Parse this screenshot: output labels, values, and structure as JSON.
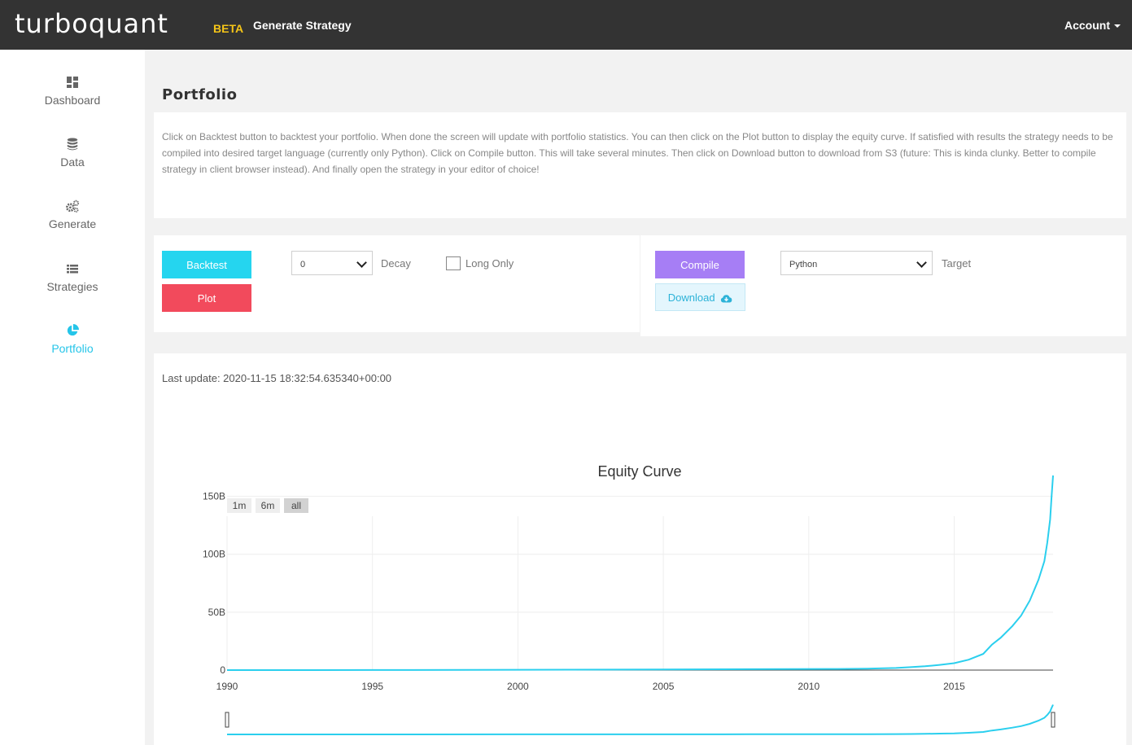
{
  "topbar": {
    "logo": "turboquant",
    "beta": "BETA",
    "generate_strategy": "Generate Strategy",
    "account": "Account"
  },
  "sidebar": {
    "items": [
      {
        "label": "Dashboard",
        "icon": "dashboard-icon",
        "active": false
      },
      {
        "label": "Data",
        "icon": "database-icon",
        "active": false
      },
      {
        "label": "Generate",
        "icon": "cogs-icon",
        "active": false
      },
      {
        "label": "Strategies",
        "icon": "list-icon",
        "active": false
      },
      {
        "label": "Portfolio",
        "icon": "pie-chart-icon",
        "active": true
      }
    ]
  },
  "page": {
    "title": "Portfolio",
    "description": "Click on Backtest button to backtest your portfolio. When done the screen will update with portfolio statistics. You can then click on the Plot button to display the equity curve. If satisfied with results the strategy needs to be compiled into desired target language (currently only Python). Click on Compile button. This will take several minutes. Then click on Download button to download from S3 (future: This is kinda clunky. Better to compile strategy in client browser instead). And finally open the strategy in your editor of choice!"
  },
  "controls": {
    "backtest_label": "Backtest",
    "plot_label": "Plot",
    "decay_value": "0",
    "decay_label": "Decay",
    "long_only_label": "Long Only",
    "long_only_checked": false,
    "compile_label": "Compile",
    "download_label": "Download",
    "target_value": "Python",
    "target_label": "Target"
  },
  "chart_panel": {
    "last_update": "Last update: 2020-11-15 18:32:54.635340+00:00"
  },
  "colors": {
    "accent": "#25c5e9",
    "backtest": "#25d5ef",
    "plot": "#f24a5c",
    "compile": "#a67ef5",
    "line": "#2bcfee"
  },
  "chart_data": {
    "type": "line",
    "title": "Equity Curve",
    "xlabel": "",
    "ylabel": "",
    "range_buttons": [
      "1m",
      "6m",
      "all"
    ],
    "active_range": "all",
    "x_ticks": [
      "1990",
      "1995",
      "2000",
      "2005",
      "2010",
      "2015"
    ],
    "y_ticks": [
      "0",
      "50B",
      "100B",
      "150B"
    ],
    "xlim": [
      1990,
      2018.4
    ],
    "ylim": [
      0,
      175
    ],
    "y_unit": "B",
    "grid": true,
    "rangeslider": true,
    "series": [
      {
        "x": [
          1990,
          1995,
          2000,
          2005,
          2008,
          2011,
          2012,
          2013,
          2013.5,
          2014,
          2014.5,
          2015,
          2015.5,
          2016,
          2016.3,
          2016.6,
          2017,
          2017.3,
          2017.6,
          2017.9,
          2018.1,
          2018.2,
          2018.3,
          2018.35,
          2018.4
        ],
        "values": [
          0,
          0.1,
          0.3,
          0.5,
          0.8,
          1.0,
          1.3,
          1.8,
          2.5,
          3.3,
          4.5,
          6.0,
          9.0,
          14.0,
          22.0,
          28.0,
          38.0,
          47.0,
          60.0,
          78.0,
          94.0,
          110.0,
          130.0,
          150.0,
          168.0
        ]
      }
    ]
  }
}
